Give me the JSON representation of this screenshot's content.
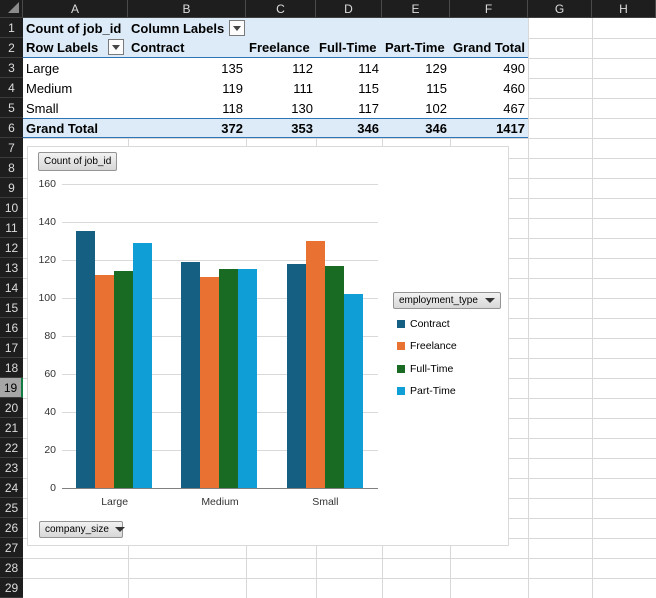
{
  "spreadsheet": {
    "column_headers": [
      "A",
      "B",
      "C",
      "D",
      "E",
      "F",
      "G",
      "H"
    ],
    "row_headers": [
      "1",
      "2",
      "3",
      "4",
      "5",
      "6",
      "7",
      "8",
      "9",
      "10",
      "11",
      "12",
      "13",
      "14",
      "15",
      "16",
      "17",
      "18",
      "19",
      "20",
      "21",
      "22",
      "23",
      "24",
      "25",
      "26",
      "27",
      "28",
      "29"
    ],
    "selected_row": "19"
  },
  "pivot": {
    "count_label": "Count of job_id",
    "column_labels_label": "Column Labels",
    "row_labels_label": "Row Labels",
    "column_headers": [
      "Contract",
      "Freelance",
      "Full-Time",
      "Part-Time",
      "Grand Total"
    ],
    "rows": [
      {
        "label": "Large",
        "values": [
          "135",
          "112",
          "114",
          "129",
          "490"
        ]
      },
      {
        "label": "Medium",
        "values": [
          "119",
          "111",
          "115",
          "115",
          "460"
        ]
      },
      {
        "label": "Small",
        "values": [
          "118",
          "130",
          "117",
          "102",
          "467"
        ]
      }
    ],
    "grand_total": {
      "label": "Grand Total",
      "values": [
        "372",
        "353",
        "346",
        "346",
        "1417"
      ]
    },
    "fill_color": "#DCEBF7",
    "border_color": "#2E75B6"
  },
  "chart_data": {
    "type": "bar",
    "value_field_button": "Count of job_id",
    "legend_field_button": "employment_type",
    "axis_field_button": "company_size",
    "categories": [
      "Large",
      "Medium",
      "Small"
    ],
    "series": [
      {
        "name": "Contract",
        "color": "#156082",
        "values": [
          135,
          119,
          118
        ]
      },
      {
        "name": "Freelance",
        "color": "#E97132",
        "values": [
          112,
          111,
          130
        ]
      },
      {
        "name": "Full-Time",
        "color": "#196B24",
        "values": [
          114,
          115,
          117
        ]
      },
      {
        "name": "Part-Time",
        "color": "#0F9ED5",
        "values": [
          129,
          115,
          102
        ]
      }
    ],
    "ylim": [
      0,
      160
    ],
    "yticks": [
      0,
      20,
      40,
      60,
      80,
      100,
      120,
      140,
      160
    ],
    "grid": true,
    "legend_position": "right"
  }
}
